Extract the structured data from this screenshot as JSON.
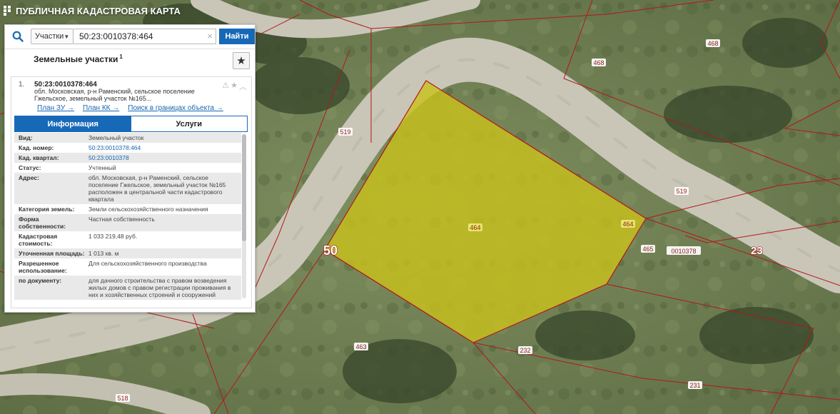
{
  "app": {
    "title": "ПУБЛИЧНАЯ КАДАСТРОВАЯ КАРТА"
  },
  "search": {
    "type_label": "Участки",
    "query": "50:23:0010378:464",
    "find_label": "Найти",
    "icon": "search-icon",
    "clear_icon": "close-icon"
  },
  "results_header": {
    "title": "Земельные участки",
    "count": "1",
    "favorite_icon": "star-icon"
  },
  "result": {
    "index": "1.",
    "cad_number": "50:23:0010378:464",
    "address_short": "обл. Московская, р-н Раменский, сельское поселение Гжельское, земельный участок №165...",
    "links": {
      "plan_zu": "План ЗУ →",
      "plan_kk": "План КК →",
      "search_bounds": "Поиск в границах объекта →"
    },
    "tabs": {
      "info": "Информация",
      "services": "Услуги"
    },
    "fields": [
      {
        "key": "Вид:",
        "value": "Земельный участок",
        "link": false
      },
      {
        "key": "Кад. номер:",
        "value": "50:23:0010378:464",
        "link": true
      },
      {
        "key": "Кад. квартал:",
        "value": "50:23:0010378",
        "link": true
      },
      {
        "key": "Статус:",
        "value": "Учтенный",
        "link": false
      },
      {
        "key": "Адрес:",
        "value": "обл. Московская, р-н Раменский, сельское поселение Гжельское, земельный участок №165 расположен в центральной части кадастрового квартала",
        "link": false
      },
      {
        "key": "Категория земель:",
        "value": "Земли сельскохозяйственного назначения",
        "link": false
      },
      {
        "key": "Форма собственности:",
        "value": "Частная собственность",
        "link": false
      },
      {
        "key": "Кадастровая стоимость:",
        "value": "1 033 219,48 руб.",
        "link": false
      },
      {
        "key": "Уточненная площадь:",
        "value": "1 013 кв. м",
        "link": false
      },
      {
        "key": "Разрешенное использование:",
        "value": "Для сельскохозяйственного производства",
        "link": false
      },
      {
        "key": "по документу:",
        "value": "для дачного строительства с правом возведения жилых домов с правом регистрации проживания в них и хозяйственных строений и сооружений",
        "link": false
      }
    ]
  },
  "map": {
    "parcel_fill": "#c9c21a",
    "boundary_color": "#b3171c",
    "labels": {
      "l468": "468",
      "l468b": "468",
      "l519": "519",
      "l519b": "519",
      "l464": "464",
      "l464b": "464",
      "l465": "465",
      "l463": "463",
      "l232": "232",
      "l231": "231",
      "l518": "518",
      "lquarter": "0010378",
      "l50": "50",
      "l23": "23"
    }
  }
}
